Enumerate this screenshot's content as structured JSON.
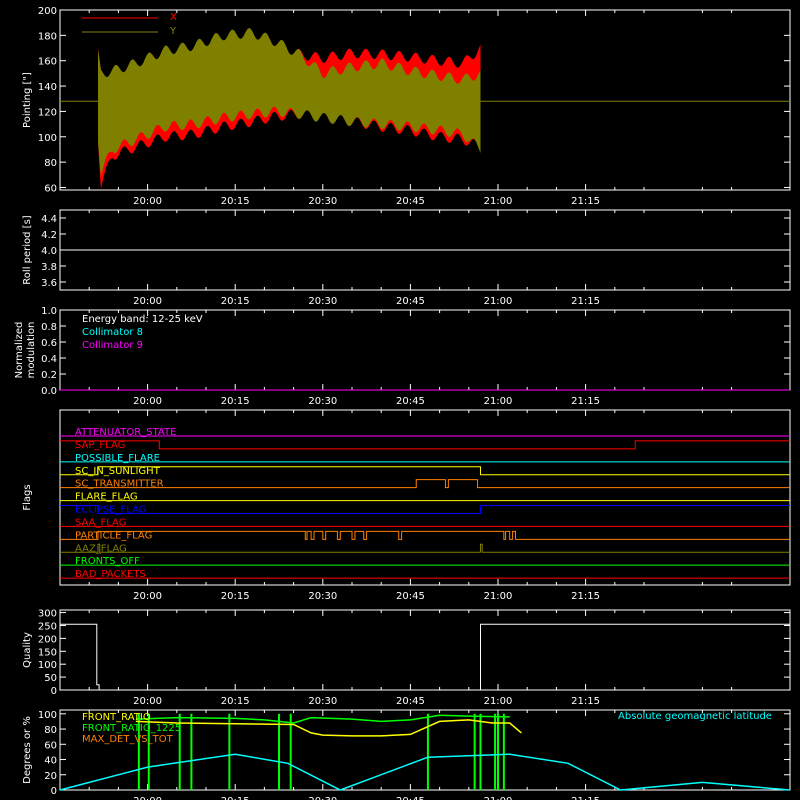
{
  "time_axis": {
    "min_minutes": 1185,
    "max_minutes": 1310,
    "tick_minutes": [
      1200,
      1215,
      1230,
      1245,
      1260,
      1275
    ],
    "tick_labels": [
      "20:00",
      "20:15",
      "20:30",
      "20:45",
      "21:00",
      "21:15"
    ]
  },
  "chart_data": [
    {
      "type": "area",
      "id": "pointing",
      "ylabel": "Pointing [\"]",
      "ylim": [
        58,
        200
      ],
      "yticks": [
        60,
        80,
        100,
        120,
        140,
        160,
        180,
        200
      ],
      "legend": [
        {
          "name": "X",
          "color": "#ff0000"
        },
        {
          "name": "Y",
          "color": "#808000"
        }
      ],
      "baseline": 128,
      "data_start": 1191.5,
      "data_end": 1257.2,
      "series": [
        {
          "name": "X",
          "color": "#ff0000",
          "t": [
            1191.5,
            1192.0,
            1194.0,
            1198.0,
            1203.0,
            1208.0,
            1213.0,
            1218.0,
            1222.0,
            1226.0,
            1230.0,
            1235.0,
            1240.0,
            1245.0,
            1250.0,
            1254.0,
            1257.0
          ],
          "upper": [
            166,
            150,
            148,
            152,
            160,
            164,
            170,
            172,
            168,
            165,
            162,
            166,
            165,
            163,
            160,
            158,
            170
          ],
          "lower": [
            100,
            62,
            85,
            92,
            100,
            102,
            108,
            112,
            116,
            118,
            118,
            112,
            108,
            105,
            100,
            98,
            92
          ]
        },
        {
          "name": "Y",
          "color": "#808000",
          "t": [
            1191.5,
            1192.0,
            1194.0,
            1198.0,
            1203.0,
            1208.0,
            1213.0,
            1218.0,
            1222.0,
            1226.0,
            1230.0,
            1235.0,
            1240.0,
            1245.0,
            1250.0,
            1254.0,
            1257.0
          ],
          "upper": [
            165,
            150,
            152,
            158,
            168,
            172,
            180,
            182,
            175,
            165,
            150,
            155,
            158,
            152,
            148,
            145,
            150
          ],
          "lower": [
            100,
            72,
            90,
            98,
            108,
            110,
            115,
            118,
            120,
            118,
            115,
            112,
            110,
            108,
            105,
            102,
            90
          ]
        }
      ]
    },
    {
      "type": "line",
      "id": "roll",
      "ylabel": "Roll period [s]",
      "ylim": [
        3.5,
        4.5
      ],
      "yticks": [
        3.6,
        3.8,
        4.0,
        4.2,
        4.4
      ],
      "ytick_labels": [
        "3.6",
        "3.8",
        "4.0",
        "4.2",
        "4.4"
      ],
      "series": [
        {
          "name": "Roll period",
          "color": "#ffffff",
          "t": [
            1185,
            1310
          ],
          "y": [
            4.0,
            4.0
          ]
        }
      ]
    },
    {
      "type": "line",
      "id": "modulation",
      "ylabel": "Normalized modulation",
      "ylim": [
        0,
        1
      ],
      "yticks": [
        0,
        0.2,
        0.4,
        0.6,
        0.8,
        1.0
      ],
      "ytick_labels": [
        "0.0",
        "0.2",
        "0.4",
        "0.6",
        "0.8",
        "1.0"
      ],
      "annotations": [
        {
          "text": "Energy band: 12-25 keV",
          "color": "#ffffff"
        },
        {
          "text": "Collimator 8",
          "color": "#00ffff"
        },
        {
          "text": "Collimator 9",
          "color": "#ff00ff"
        }
      ],
      "series": [
        {
          "name": "Collimator 9",
          "color": "#ff00ff",
          "t": [
            1185,
            1310
          ],
          "y": [
            0.0,
            0.0
          ]
        }
      ]
    },
    {
      "type": "line",
      "id": "flags",
      "ylabel": "Flags",
      "flags": [
        {
          "name": "ATTENUATOR_STATE",
          "color": "#ff00ff",
          "steps": [
            [
              1185,
              0
            ]
          ]
        },
        {
          "name": "SAP_FLAG",
          "color": "#ff0000",
          "steps": [
            [
              1185,
              1
            ],
            [
              1202.0,
              0
            ],
            [
              1283.5,
              1
            ]
          ]
        },
        {
          "name": "POSSIBLE_FLARE",
          "color": "#00ffff",
          "steps": [
            [
              1185,
              0
            ]
          ]
        },
        {
          "name": "SC_IN_SUNLIGHT",
          "color": "#ffff00",
          "steps": [
            [
              1185,
              0
            ],
            [
              1191.5,
              1
            ],
            [
              1257.0,
              0
            ]
          ]
        },
        {
          "name": "SC_TRANSMITTER",
          "color": "#ff8000",
          "steps": [
            [
              1185,
              0
            ],
            [
              1246.0,
              1
            ],
            [
              1251.0,
              0
            ],
            [
              1251.5,
              1
            ],
            [
              1256.5,
              0
            ]
          ]
        },
        {
          "name": "FLARE_FLAG",
          "color": "#ffff00",
          "steps": [
            [
              1185,
              0
            ]
          ]
        },
        {
          "name": "ECLIPSE_FLAG",
          "color": "#0000ff",
          "steps": [
            [
              1185,
              1
            ],
            [
              1191.5,
              0
            ],
            [
              1257.0,
              1
            ]
          ]
        },
        {
          "name": "SAA_FLAG",
          "color": "#ff0000",
          "steps": [
            [
              1185,
              0
            ]
          ]
        },
        {
          "name": "PARTICLE_FLAG",
          "color": "#ff8000",
          "steps": [
            [
              1185,
              0
            ],
            [
              1191.5,
              1
            ],
            [
              1227.0,
              0
            ],
            [
              1227.3,
              1
            ],
            [
              1228.0,
              0
            ],
            [
              1228.5,
              1
            ],
            [
              1230.0,
              0
            ],
            [
              1230.5,
              1
            ],
            [
              1232.5,
              0
            ],
            [
              1233.0,
              1
            ],
            [
              1235.0,
              0
            ],
            [
              1235.5,
              1
            ],
            [
              1237.0,
              0
            ],
            [
              1237.5,
              1
            ],
            [
              1243.0,
              0
            ],
            [
              1243.5,
              1
            ],
            [
              1261.0,
              0
            ],
            [
              1261.3,
              1
            ],
            [
              1262.0,
              0
            ],
            [
              1262.5,
              1
            ],
            [
              1263.0,
              0
            ]
          ]
        },
        {
          "name": "AAZ_FLAG",
          "color": "#808000",
          "steps": [
            [
              1185,
              0
            ],
            [
              1191.5,
              1
            ],
            [
              1191.8,
              0
            ],
            [
              1257.0,
              1
            ],
            [
              1257.3,
              0
            ]
          ]
        },
        {
          "name": "FRONTS_OFF",
          "color": "#00ff00",
          "steps": [
            [
              1185,
              0
            ]
          ]
        },
        {
          "name": "BAD_PACKETS",
          "color": "#ff0000",
          "steps": [
            [
              1185,
              0
            ]
          ]
        }
      ]
    },
    {
      "type": "line",
      "id": "quality",
      "ylabel": "Quality",
      "ylim": [
        0,
        310
      ],
      "yticks": [
        0,
        50,
        100,
        150,
        200,
        250,
        300
      ],
      "series": [
        {
          "name": "Quality",
          "color": "#ffffff",
          "t": [
            1185,
            1191.3,
            1191.3,
            1191.7,
            1191.7,
            1257.0,
            1257.0,
            1310
          ],
          "y": [
            255,
            255,
            20,
            20,
            0,
            0,
            255,
            255
          ]
        }
      ]
    },
    {
      "type": "line",
      "id": "degrees",
      "ylabel": "Degrees or %",
      "ylim": [
        0,
        105
      ],
      "yticks": [
        0,
        20,
        40,
        60,
        80,
        100
      ],
      "legend": [
        {
          "name": "FRONT_RATIO",
          "color": "#ffff00"
        },
        {
          "name": "FRONT_RATIO_1225",
          "color": "#00ff00"
        },
        {
          "name": "MAX_DET_VS_TOT",
          "color": "#ff8000"
        }
      ],
      "annotation": {
        "text": "Absolute geomagnetic latitude",
        "color": "#00ffff"
      },
      "spikes": [
        1198.5,
        1200.2,
        1205.5,
        1207.5,
        1214.0,
        1222.5,
        1224.5,
        1248.0,
        1256.0,
        1257.0,
        1259.5,
        1260.0,
        1261.0
      ],
      "series": [
        {
          "name": "Absolute geomagnetic latitude",
          "color": "#00ffff",
          "t": [
            1185,
            1200,
            1215,
            1224,
            1233,
            1248,
            1262,
            1272,
            1281,
            1295,
            1310
          ],
          "y": [
            0,
            30,
            47,
            35,
            0,
            43,
            47,
            35,
            0,
            10,
            0
          ]
        },
        {
          "name": "FRONT_RATIO",
          "color": "#ffff00",
          "t": [
            1198,
            1205,
            1215,
            1225,
            1228,
            1230,
            1235,
            1240,
            1245,
            1250,
            1255,
            1259,
            1262,
            1264
          ],
          "y": [
            90,
            88,
            87,
            86,
            75,
            72,
            71,
            71,
            73,
            90,
            92,
            88,
            88,
            75
          ]
        },
        {
          "name": "FRONT_RATIO_1225",
          "color": "#00ff00",
          "t": [
            1198,
            1205,
            1215,
            1220,
            1225,
            1228,
            1235,
            1240,
            1245,
            1250,
            1255,
            1262
          ],
          "y": [
            93,
            95,
            94,
            92,
            88,
            95,
            93,
            90,
            92,
            98,
            97,
            96
          ]
        }
      ]
    }
  ]
}
